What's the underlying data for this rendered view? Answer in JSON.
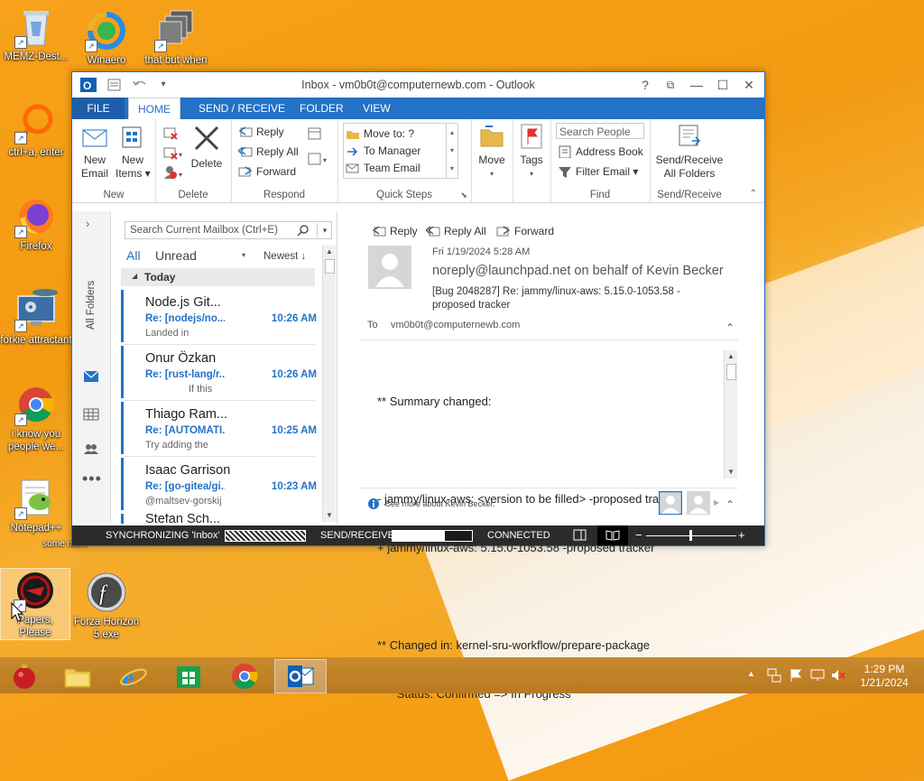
{
  "desktop": {
    "icons": [
      {
        "label": "MEMZ-Dest...",
        "icon": "recycle-bin-icon"
      },
      {
        "label": "Winaero",
        "icon": "winaero-icon"
      },
      {
        "label": "that but when",
        "icon": "shortcut-stack-icon"
      },
      {
        "label": "ctrl+a, enter",
        "icon": "ring-icon"
      },
      {
        "label": "Firefox",
        "icon": "firefox-icon"
      },
      {
        "label": "forkie attractant",
        "icon": "monitor-gear-icon"
      },
      {
        "label": "i know you people we...",
        "icon": "chrome-icon"
      },
      {
        "label": "Notepad++",
        "icon": "notepadpp-icon"
      },
      {
        "label": "Papers, Please",
        "icon": "papers-please-icon"
      },
      {
        "label": "Forza Horizon 5.exe",
        "icon": "flash-icon"
      }
    ],
    "partial_text": "some rsom"
  },
  "window": {
    "title": "Inbox - vm0b0t@computernewb.com - Outlook",
    "controls": {
      "help": "?",
      "ribbon": "⧉",
      "minimize": "—",
      "maximize": "☐",
      "close": "✕"
    }
  },
  "ribbon": {
    "tabs": [
      "FILE",
      "HOME",
      "SEND / RECEIVE",
      "FOLDER",
      "VIEW"
    ],
    "new": {
      "email": "New\nEmail",
      "items": "New\nItems ▾",
      "label": "New"
    },
    "delete": {
      "button": "Delete",
      "label": "Delete"
    },
    "respond": {
      "reply": "Reply",
      "reply_all": "Reply All",
      "forward": "Forward",
      "label": "Respond"
    },
    "quick_steps": {
      "items": [
        "Move to: ?",
        "To Manager",
        "Team Email"
      ],
      "label": "Quick Steps"
    },
    "move": {
      "button": "Move",
      "label": ""
    },
    "tags": {
      "button": "Tags"
    },
    "find": {
      "search_placeholder": "Search People",
      "address_book": "Address Book",
      "filter_email": "Filter Email ▾",
      "label": "Find"
    },
    "send_receive": {
      "button": "Send/Receive\nAll Folders",
      "label": "Send/Receive"
    }
  },
  "nav": {
    "folders_label": "All Folders"
  },
  "list": {
    "search_placeholder": "Search Current Mailbox (Ctrl+E)",
    "filter_all": "All",
    "filter_unread": "Unread",
    "sort": "Newest ↓",
    "group": "Today",
    "messages": [
      {
        "from": "Node.js Git...",
        "subject": "Re: [nodejs/no...",
        "time": "10:26 AM",
        "preview": "Landed in"
      },
      {
        "from": "Onur Özkan",
        "subject": "Re: [rust-lang/r...",
        "time": "10:26 AM",
        "preview": "If this"
      },
      {
        "from": "Thiago Ram...",
        "subject": "Re: [AUTOMATI...",
        "time": "10:25 AM",
        "preview": "Try adding the"
      },
      {
        "from": "Isaac Garrison",
        "subject": "Re: [go-gitea/gi...",
        "time": "10:23 AM",
        "preview": "@maltsev-gorskij"
      },
      {
        "from": "Stefan Sch...",
        "subject": "",
        "time": "",
        "preview": ""
      }
    ]
  },
  "reading": {
    "actions": {
      "reply": "Reply",
      "reply_all": "Reply All",
      "forward": "Forward"
    },
    "date": "Fri 1/19/2024 5:28 AM",
    "sender": "noreply@launchpad.net on behalf of Kevin Becker",
    "subject": "[Bug 2048287] Re: jammy/linux-aws: 5.15.0-1053.58 -\nproposed tracker",
    "to_label": "To",
    "to": "vm0b0t@computernewb.com",
    "body": [
      "** Summary changed:",
      "",
      "- jammy/linux-aws: <version to be filled> -proposed tracker",
      "+ jammy/linux-aws: 5.15.0-1053.58 -proposed tracker",
      "",
      "** Changed in: kernel-sru-workflow/prepare-package",
      "      Status: Confirmed => In Progress"
    ],
    "people_info": "See more about Kevin Becker."
  },
  "status": {
    "sync": "SYNCHRONIZING  'Inbox'",
    "send_receive": "SEND/RECEIVE",
    "send_receive_progress": 0.66,
    "connection": "CONNECTED",
    "zoom_minus": "−",
    "zoom_plus": "+"
  },
  "taskbar": {
    "apps": [
      "memz-ornament-icon",
      "file-explorer-icon",
      "internet-explorer-icon",
      "store-icon",
      "chrome-icon",
      "outlook-icon"
    ],
    "time": "1:29 PM",
    "date": "1/21/2024"
  },
  "colors": {
    "accent": "#2372c6",
    "taskbar": "#bf8026"
  }
}
